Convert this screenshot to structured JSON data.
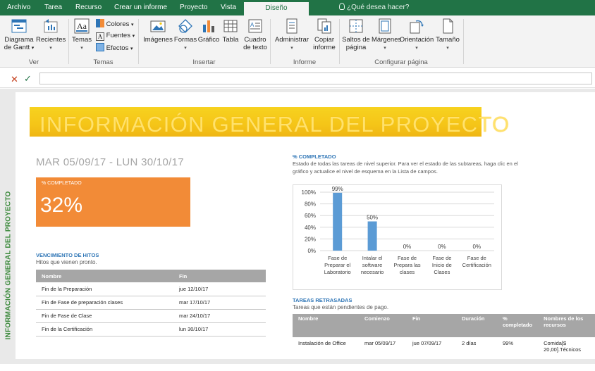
{
  "menubar": {
    "tabs": [
      "Archivo",
      "Tarea",
      "Recurso",
      "Crear un informe",
      "Proyecto",
      "Vista",
      "Diseño"
    ],
    "active_tab": "Diseño",
    "tell_me": "¿Qué desea hacer?",
    "accent": "#217346"
  },
  "ribbon": {
    "ver": {
      "gantt_line1": "Diagrama",
      "gantt_line2": "de Gantt",
      "recent": "Recientes",
      "group": "Ver"
    },
    "temas": {
      "temas": "Temas",
      "colores": "Colores",
      "fuentes": "Fuentes",
      "efectos": "Efectos",
      "group": "Temas"
    },
    "insertar": {
      "imagenes": "Imágenes",
      "formas": "Formas",
      "grafico": "Gráfico",
      "tabla": "Tabla",
      "cuadro_line1": "Cuadro",
      "cuadro_line2": "de texto",
      "group": "Insertar"
    },
    "informe": {
      "administrar": "Administrar",
      "copiar_line1": "Copiar",
      "copiar_line2": "informe",
      "group": "Informe"
    },
    "pagina": {
      "saltos_line1": "Saltos de",
      "saltos_line2": "página",
      "margenes": "Márgenes",
      "orientacion": "Orientación",
      "tamano": "Tamaño",
      "group": "Configurar página"
    }
  },
  "report": {
    "side_title": "INFORMACIÓN GENERAL DEL PROYECTO",
    "banner_title": "INFORMACIÓN GENERAL DEL PROYECTO",
    "date_range": "MAR 05/09/17 - LUN 30/10/17",
    "pct_card": {
      "label": "% COMPLETADO",
      "value": "32%",
      "color": "#f28b37"
    },
    "milestones": {
      "title": "VENCIMIENTO DE HITOS",
      "subtitle": "Hitos que vienen pronto.",
      "headers": [
        "Nombre",
        "Fin"
      ],
      "rows": [
        [
          "Fin de la Preparación",
          "jue 12/10/17"
        ],
        [
          "Fin de Fase de preparación clases",
          "mar 17/10/17"
        ],
        [
          "Fin de Fase de Clase",
          "mar 24/10/17"
        ],
        [
          "Fin de la Certificación",
          "lun 30/10/17"
        ]
      ]
    },
    "completion": {
      "title": "% COMPLETADO",
      "description_line1": "Estado de todas las tareas de nivel superior. Para ver el estado de las subtareas, haga clic en el",
      "description_line2": "gráfico y actualice el nivel de esquema en la Lista de campos."
    },
    "late_tasks": {
      "title": "TAREAS RETRASADAS",
      "subtitle": "Tareas que están pendientes de pago.",
      "headers": [
        "Nombre",
        "Comienzo",
        "Fin",
        "Duración",
        "% completado",
        "Nombres de los recursos"
      ],
      "rows": [
        [
          "Instalación de Office",
          "mar 05/09/17",
          "jue 07/09/17",
          "2 días",
          "99%",
          "Comida[$ 20,00].Técnicos"
        ]
      ]
    }
  },
  "chart_data": {
    "type": "bar",
    "categories": [
      "Fase de Preparar el Laboratorio",
      "Intalar el software necesario",
      "Fase de Prepara las clases",
      "Fase de Inicio de Clases",
      "Fase de Certificación"
    ],
    "category_lines": [
      [
        "Fase de",
        "Preparar el",
        "Laboratorio"
      ],
      [
        "Intalar el",
        "software",
        "necesario"
      ],
      [
        "Fase de",
        "Prepara las",
        "clases"
      ],
      [
        "Fase de",
        "Inicio de",
        "Clases"
      ],
      [
        "Fase de",
        "Certificación"
      ]
    ],
    "values": [
      99,
      50,
      0,
      0,
      0
    ],
    "data_labels": [
      "99%",
      "50%",
      "0%",
      "0%",
      "0%"
    ],
    "yticks": [
      "0%",
      "20%",
      "40%",
      "60%",
      "80%",
      "100%"
    ],
    "ylim": [
      0,
      100
    ],
    "grid": true,
    "bar_color": "#5b9bd5"
  }
}
